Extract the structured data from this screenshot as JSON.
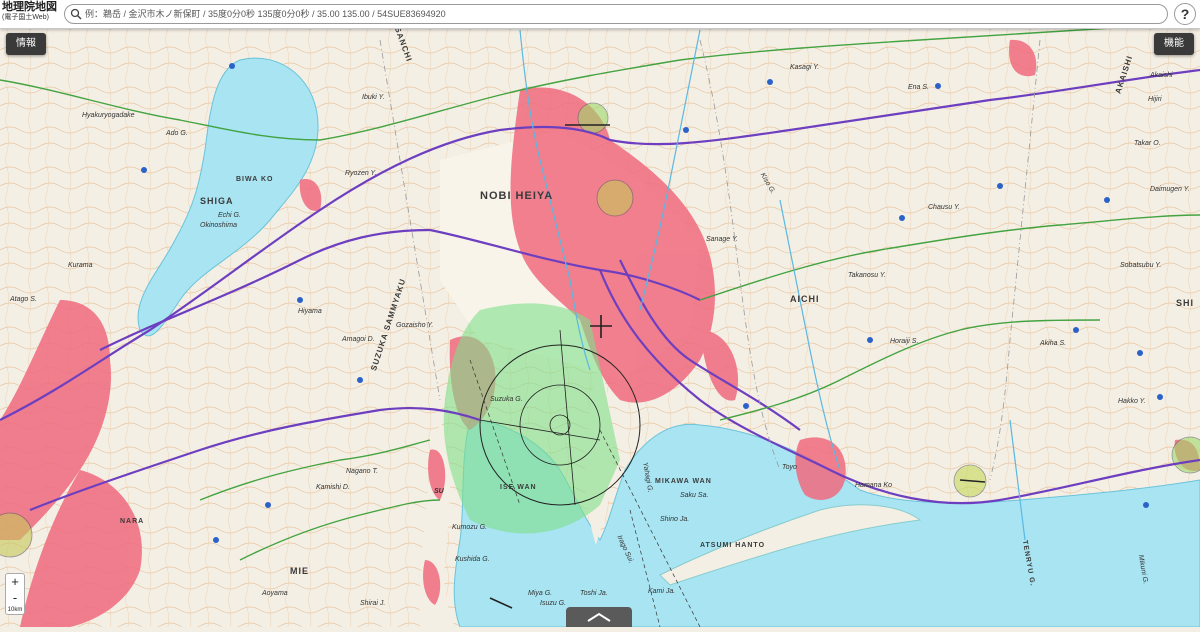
{
  "app": {
    "title": "地理院地図",
    "subtitle": "(電子国土Web)"
  },
  "search": {
    "placeholder": "例：鵜岳 / 金沢市木ノ新保町 / 35度0分0秒 135度0分0秒 / 35.00 135.00 / 54SUE83694920"
  },
  "buttons": {
    "info_label": "情報",
    "function_label": "機能",
    "help_label": "?"
  },
  "zoom": {
    "plus": "+",
    "minus": "-",
    "scale_text": "10km"
  },
  "icons": [
    "search-icon",
    "help-icon",
    "zoom-in-icon",
    "zoom-out-icon",
    "chevron-up-icon",
    "airport-icon",
    "road-marker-icon"
  ],
  "colors": {
    "water": "#a8e4f2",
    "land": "#f4efe4",
    "urban": "#f06a7e",
    "road_main": "#6d3fc0",
    "road_secondary": "#43a340",
    "contour": "#d9a478",
    "airspace_fill": "#7fe08a",
    "toolbar": "#3a3a3a"
  },
  "map_labels": {
    "shiga": "SHIGA",
    "biwa_ko": "BIWA KO",
    "nobi_heiya": "NOBI HEIYA",
    "aichi": "AICHI",
    "mie": "MIE",
    "ise_wan": "ISE WAN",
    "mikawa_wan": "MIKAWA WAN",
    "suzuka_sammyaku": "SUZUKA SAMMYAKU",
    "atsumi_hanto": "ATSUMI HANTO",
    "akaishi": "AKAISHI",
    "ibuki_sanchi": "SANCHI",
    "suzuka_g": "Suzuka G.",
    "hamana_ko": "Hamana Ko",
    "toyo": "Toyo",
    "echi_g": "Echi G.",
    "okinoshima": "Okinoshima",
    "ryozen_y": "Ryozen Y.",
    "gozaisho": "Gozaisho Y.",
    "takanosu": "Takanosu Y.",
    "sanage": "Sanage Y.",
    "chausu": "Chausu Y.",
    "kumozu": "Kumozu G.",
    "kushida": "Kushida G.",
    "nagano": "Nagano T.",
    "saku": "Saku Sa.",
    "shino": "Shino Ja.",
    "hyakuryogadake": "Hyakuryogadake",
    "kurama": "Kurama",
    "atago": "Atago S.",
    "ado_g": "Ado G.",
    "kasagi": "Kasagi Y.",
    "ibuki": "Ibuki Y.",
    "haccho": "Hakko Y.",
    "ena": "Ena S.",
    "tenryu": "TENRYU G.",
    "daimugen": "Daimugen Y.",
    "sobatsubu": "Sobatsubu Y.",
    "horaiji": "Horaiji S.",
    "akiha": "Akiha S.",
    "yahagi": "Yahagi G.",
    "shiraj": "Shirai J.",
    "miya_g": "Miya G.",
    "kami_ja": "Kami Ja.",
    "irago": "Irago Sui.",
    "toshi_ja": "Toshi Ja.",
    "isuzu": "Isuzu G.",
    "nara": "NARA",
    "shi": "SHI",
    "takaristart": "Takar O.",
    "hiyama": "Hiyama",
    "amagoi": "Amagoi D.",
    "hijiri": "Hijiri",
    "tsu": "SU",
    "shiga_kushi": "Aoyama",
    "kuboi": "Kamishi D.",
    "akaishi2": "Akaishi",
    "kiso": "Kiso G.",
    "mikuni": "Mikuni G."
  }
}
